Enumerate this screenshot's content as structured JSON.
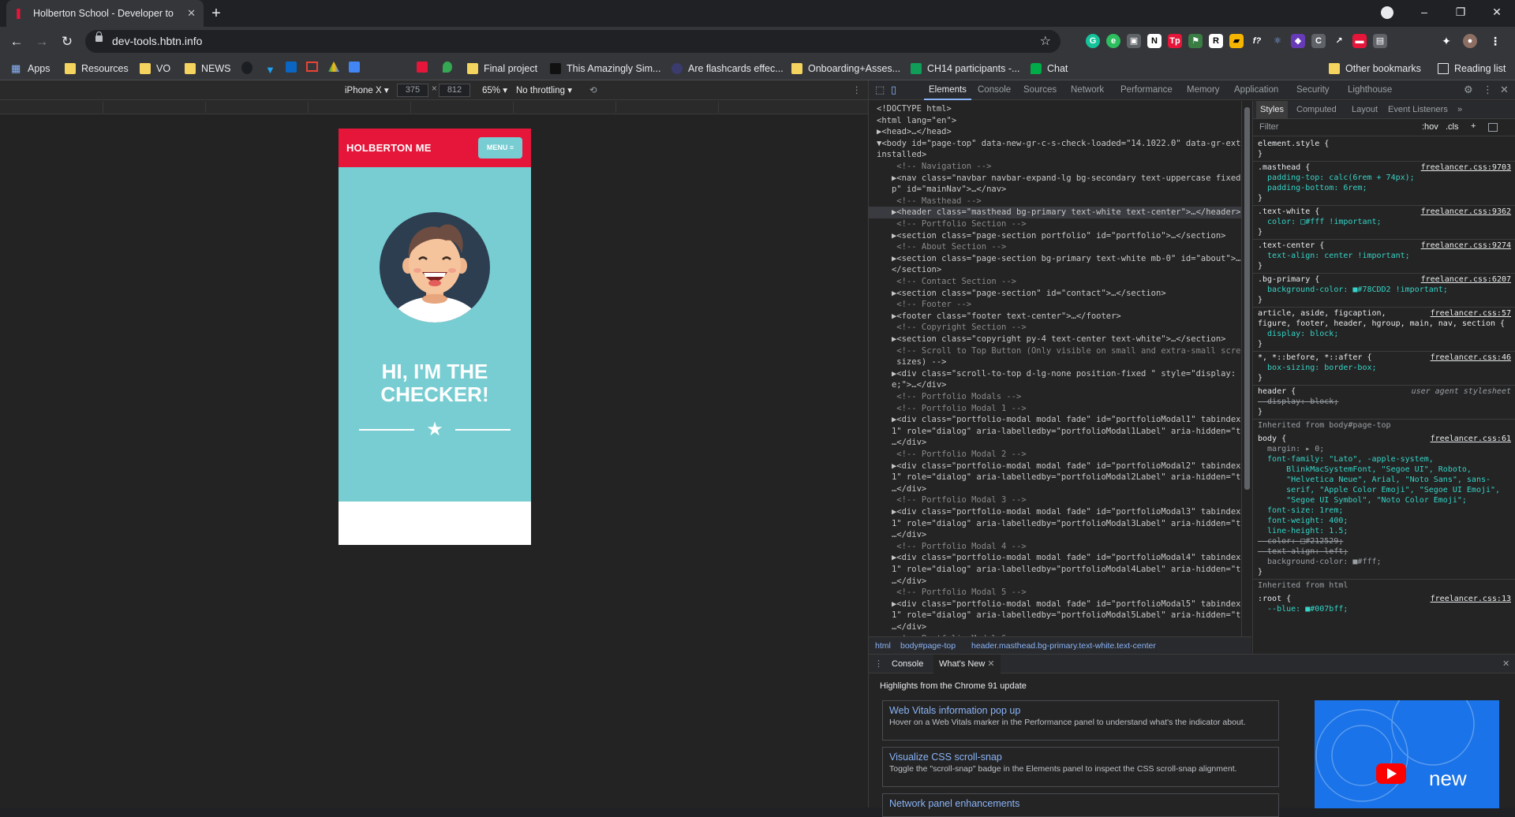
{
  "browser": {
    "tab_title": "Holberton School - Developer to",
    "url": "dev-tools.hbtn.info",
    "window_controls": [
      "–",
      "❐",
      "✕"
    ]
  },
  "bookmarks": [
    {
      "label": "Apps",
      "icon": "apps-grid-icon"
    },
    {
      "label": "Resources",
      "icon": "folder-icon"
    },
    {
      "label": "VO",
      "icon": "folder-icon"
    },
    {
      "label": "NEWS",
      "icon": "folder-icon"
    },
    {
      "label": "Final project",
      "icon": "folder-icon"
    },
    {
      "label": "This Amazingly Sim...",
      "icon": "site-icon"
    },
    {
      "label": "Are flashcards effec...",
      "icon": "site-icon"
    },
    {
      "label": "Onboarding+Asses...",
      "icon": "folder-icon"
    },
    {
      "label": "CH14 participants -...",
      "icon": "sheets-icon"
    },
    {
      "label": "Chat",
      "icon": "chat-icon"
    },
    {
      "label": "Other bookmarks",
      "icon": "folder-icon"
    },
    {
      "label": "Reading list",
      "icon": "reading-list-icon"
    }
  ],
  "device_toolbar": {
    "device": "iPhone X",
    "width": "375",
    "height": "812",
    "times": "×",
    "zoom": "65%",
    "throttle": "No throttling"
  },
  "page": {
    "brand": "HOLBERTON ME",
    "menu_label": "MENU ≡",
    "heading_line1": "HI, I'M THE",
    "heading_line2": "CHECKER!"
  },
  "devtools": {
    "tabs": [
      "Elements",
      "Console",
      "Sources",
      "Network",
      "Performance",
      "Memory",
      "Application",
      "Security",
      "Lighthouse"
    ],
    "active_tab": "Elements",
    "dom_lines": [
      "<!DOCTYPE html>",
      "<html lang=\"en\">",
      "▶<head>…</head>",
      "▼<body id=\"page-top\" data-new-gr-c-s-check-loaded=\"14.1022.0\" data-gr-ext-",
      "installed>",
      "    <!-- Navigation -->",
      "   ▶<nav class=\"navbar navbar-expand-lg bg-secondary text-uppercase fixed-to",
      "   p\" id=\"mainNav\">…</nav>",
      "    <!-- Masthead -->",
      "   ▶<header class=\"masthead bg-primary text-white text-center\">…</header> == $0",
      "    <!-- Portfolio Section -->",
      "   ▶<section class=\"page-section portfolio\" id=\"portfolio\">…</section>",
      "    <!-- About Section -->",
      "   ▶<section class=\"page-section bg-primary text-white mb-0\" id=\"about\">…",
      "   </section>",
      "    <!-- Contact Section -->",
      "   ▶<section class=\"page-section\" id=\"contact\">…</section>",
      "    <!-- Footer -->",
      "   ▶<footer class=\"footer text-center\">…</footer>",
      "    <!-- Copyright Section -->",
      "   ▶<section class=\"copyright py-4 text-center text-white\">…</section>",
      "    <!-- Scroll to Top Button (Only visible on small and extra-small screen",
      "    sizes) -->",
      "   ▶<div class=\"scroll-to-top d-lg-none position-fixed \" style=\"display: non",
      "   e;\">…</div>",
      "    <!-- Portfolio Modals -->",
      "    <!-- Portfolio Modal 1 -->",
      "   ▶<div class=\"portfolio-modal modal fade\" id=\"portfolioModal1\" tabindex=\"-",
      "   1\" role=\"dialog\" aria-labelledby=\"portfolioModal1Label\" aria-hidden=\"true\">",
      "   …</div>",
      "    <!-- Portfolio Modal 2 -->",
      "   ▶<div class=\"portfolio-modal modal fade\" id=\"portfolioModal2\" tabindex=\"-",
      "   1\" role=\"dialog\" aria-labelledby=\"portfolioModal2Label\" aria-hidden=\"true\">",
      "   …</div>",
      "    <!-- Portfolio Modal 3 -->",
      "   ▶<div class=\"portfolio-modal modal fade\" id=\"portfolioModal3\" tabindex=\"-",
      "   1\" role=\"dialog\" aria-labelledby=\"portfolioModal3Label\" aria-hidden=\"true\">",
      "   …</div>",
      "    <!-- Portfolio Modal 4 -->",
      "   ▶<div class=\"portfolio-modal modal fade\" id=\"portfolioModal4\" tabindex=\"-",
      "   1\" role=\"dialog\" aria-labelledby=\"portfolioModal4Label\" aria-hidden=\"true\">",
      "   …</div>",
      "    <!-- Portfolio Modal 5 -->",
      "   ▶<div class=\"portfolio-modal modal fade\" id=\"portfolioModal5\" tabindex=\"-",
      "   1\" role=\"dialog\" aria-labelledby=\"portfolioModal5Label\" aria-hidden=\"true\">",
      "   …</div>",
      "    <!-- Portfolio Modal 6 -->"
    ],
    "selected_line": 9,
    "breadcrumbs": [
      "html",
      "body#page-top",
      "header.masthead.bg-primary.text-white.text-center"
    ],
    "styles_tabs": [
      "Styles",
      "Computed",
      "Layout",
      "Event Listeners",
      "»"
    ],
    "filter_placeholder": "Filter",
    "filter_tools": [
      ":hov",
      ".cls",
      "+"
    ],
    "style_lines": [
      {
        "text": "element.style {",
        "src": ""
      },
      {
        "text": "}",
        "src": ""
      },
      {
        "text": ".masthead {",
        "src": "freelancer.css:9703"
      },
      {
        "text": "  padding-top: calc(6rem + 74px);",
        "src": ""
      },
      {
        "text": "  padding-bottom: 6rem;",
        "src": ""
      },
      {
        "text": "}",
        "src": ""
      },
      {
        "text": ".text-white {",
        "src": "freelancer.css:9362"
      },
      {
        "text": "  color: □#fff !important;",
        "src": ""
      },
      {
        "text": "}",
        "src": ""
      },
      {
        "text": ".text-center {",
        "src": "freelancer.css:9274"
      },
      {
        "text": "  text-align: center !important;",
        "src": ""
      },
      {
        "text": "}",
        "src": ""
      },
      {
        "text": ".bg-primary {",
        "src": "freelancer.css:6207"
      },
      {
        "text": "  background-color: ■#78CDD2 !important;",
        "src": ""
      },
      {
        "text": "}",
        "src": ""
      },
      {
        "text": "article, aside, figcaption,",
        "src": "freelancer.css:57"
      },
      {
        "text": "figure, footer, header, hgroup, main, nav, section {",
        "src": ""
      },
      {
        "text": "  display: block;",
        "src": ""
      },
      {
        "text": "}",
        "src": ""
      },
      {
        "text": "*, *::before, *::after {",
        "src": "freelancer.css:46"
      },
      {
        "text": "  box-sizing: border-box;",
        "src": ""
      },
      {
        "text": "}",
        "src": ""
      },
      {
        "text": "header {",
        "src": "user agent stylesheet"
      },
      {
        "text": "  display: block;",
        "src": ""
      },
      {
        "text": "}",
        "src": ""
      },
      {
        "text": "Inherited from body#page-top",
        "src": ""
      },
      {
        "text": "body {",
        "src": "freelancer.css:61"
      },
      {
        "text": "  margin: ▸ 0;",
        "src": ""
      },
      {
        "text": "  font-family: \"Lato\", -apple-system,",
        "src": ""
      },
      {
        "text": "      BlinkMacSystemFont, \"Segoe UI\", Roboto,",
        "src": ""
      },
      {
        "text": "      \"Helvetica Neue\", Arial, \"Noto Sans\", sans-",
        "src": ""
      },
      {
        "text": "      serif, \"Apple Color Emoji\", \"Segoe UI Emoji\",",
        "src": ""
      },
      {
        "text": "      \"Segoe UI Symbol\", \"Noto Color Emoji\";",
        "src": ""
      },
      {
        "text": "  font-size: 1rem;",
        "src": ""
      },
      {
        "text": "  font-weight: 400;",
        "src": ""
      },
      {
        "text": "  line-height: 1.5;",
        "src": ""
      },
      {
        "text": "  color: □#212529;",
        "src": ""
      },
      {
        "text": "  text-align: left;",
        "src": ""
      },
      {
        "text": "  background-color: ■#fff;",
        "src": ""
      },
      {
        "text": "}",
        "src": ""
      },
      {
        "text": "Inherited from html",
        "src": ""
      },
      {
        "text": ":root {",
        "src": "freelancer.css:13"
      },
      {
        "text": "  --blue: ■#007bff;",
        "src": ""
      }
    ],
    "drawer_tabs": [
      "Console",
      "What's New"
    ],
    "drawer_active": "What's New",
    "highlights_title": "Highlights from the Chrome 91 update",
    "cards": [
      {
        "title": "Web Vitals information pop up",
        "desc": "Hover on a Web Vitals marker in the Performance panel to understand what's the indicator about."
      },
      {
        "title": "Visualize CSS scroll-snap",
        "desc": "Toggle the \"scroll-snap\" badge in the Elements panel to inspect the CSS scroll-snap alignment."
      },
      {
        "title": "Network panel enhancements",
        "desc": ""
      }
    ],
    "promo_text": "new"
  },
  "colors": {
    "brand_red": "#e5163a",
    "teal": "#78CDD2",
    "devtools_bg": "#242424",
    "link_blue": "#8ab4f8"
  }
}
